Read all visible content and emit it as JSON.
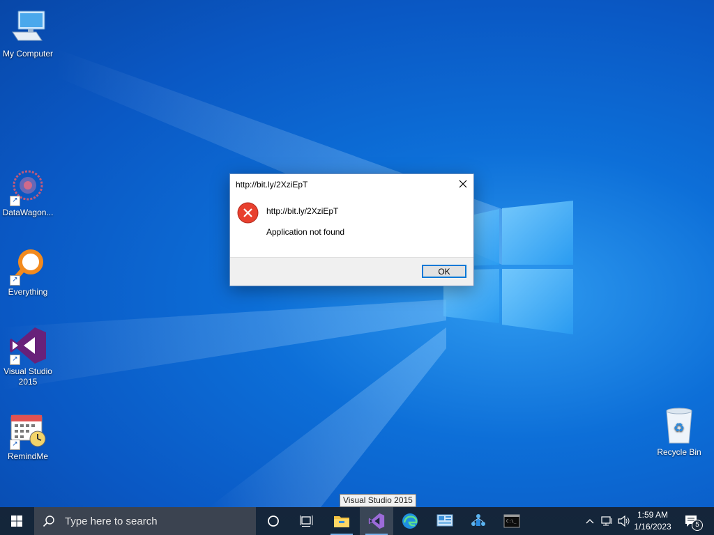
{
  "desktop": {
    "icons": [
      {
        "label": "My Computer",
        "icon": "computer-icon"
      },
      {
        "label": "DataWagon...",
        "icon": "datawagon-icon"
      },
      {
        "label": "Everything",
        "icon": "everything-search-icon"
      },
      {
        "label": "Visual Studio 2015",
        "icon": "visual-studio-icon"
      },
      {
        "label": "RemindMe",
        "icon": "calendar-clock-icon"
      },
      {
        "label": "Recycle Bin",
        "icon": "recycle-bin-icon"
      }
    ]
  },
  "dialog": {
    "title": "http://bit.ly/2XziEpT",
    "message_line1": "http://bit.ly/2XziEpT",
    "message_line2": "Application not found",
    "ok_label": "OK",
    "icon": "error-icon"
  },
  "tooltip": {
    "text": "Visual Studio 2015"
  },
  "taskbar": {
    "search_placeholder": "Type here to search",
    "apps": [
      "cortana-icon",
      "task-view-icon",
      "file-explorer-icon",
      "visual-studio-icon",
      "edge-icon",
      "control-panel-icon",
      "network-app-icon",
      "terminal-icon"
    ],
    "time": "1:59 AM",
    "date": "1/16/2023",
    "notification_count": "5"
  }
}
